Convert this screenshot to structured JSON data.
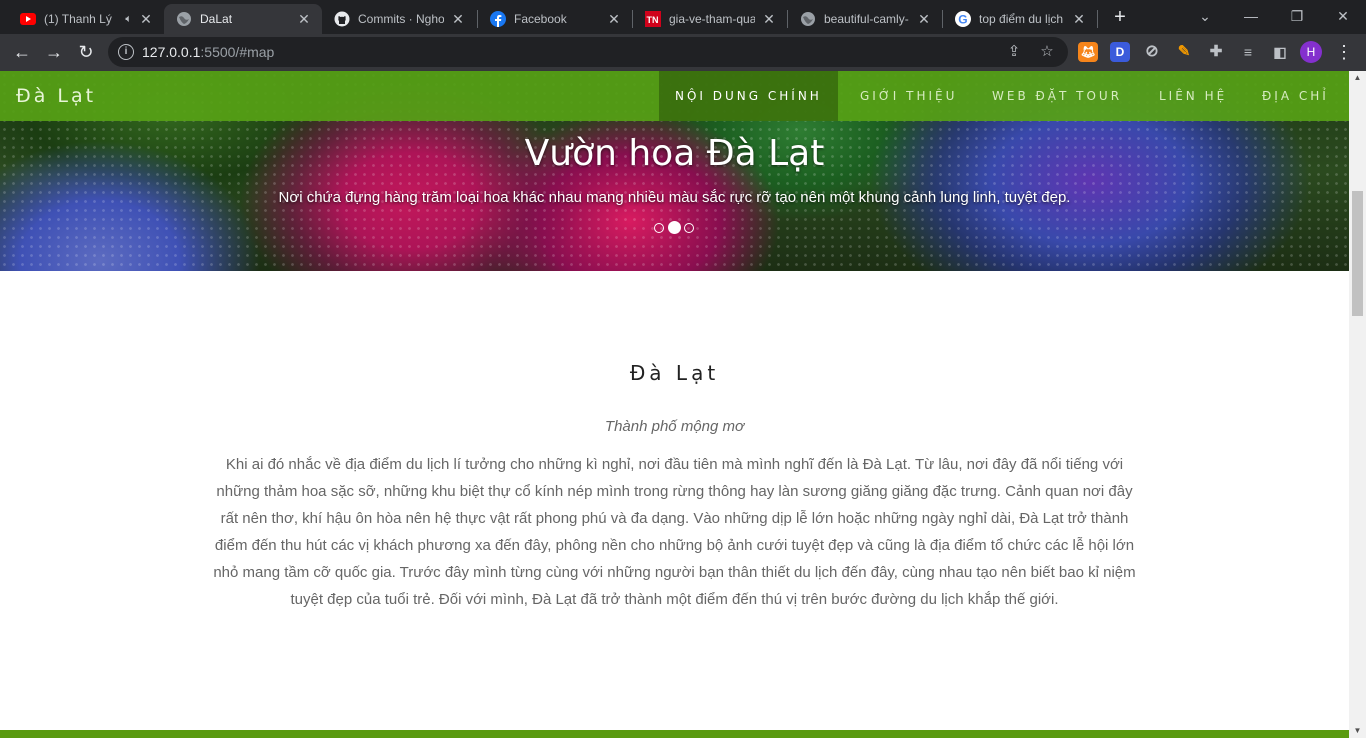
{
  "browser": {
    "tabs": [
      {
        "title": "(1) Thanh Lý",
        "icon": "youtube-icon",
        "muted_audio": true,
        "active": false
      },
      {
        "title": "DaLat",
        "icon": "globe-icon",
        "active": true
      },
      {
        "title": "Commits · Nghoa",
        "icon": "github-icon",
        "active": false
      },
      {
        "title": "Facebook",
        "icon": "facebook-icon",
        "active": false
      },
      {
        "title": "gia-ve-tham-qua",
        "icon": "thanhnien-icon",
        "active": false
      },
      {
        "title": "beautiful-camly-",
        "icon": "globe-icon",
        "active": false
      },
      {
        "title": "top điểm du lịch",
        "icon": "google-icon",
        "active": false
      }
    ],
    "url_host": "127.0.0.1",
    "url_rest": ":5500/#map",
    "profile_initial": "H",
    "ext_d_label": "D"
  },
  "site": {
    "brand": "Đà Lạt",
    "nav": [
      "NỘI DUNG CHÍNH",
      "GIỚI THIỆU",
      "WEB ĐẶT TOUR",
      "LIÊN HỆ",
      "ĐỊA CHỈ"
    ],
    "nav_active_index": 0,
    "accent": "#56a016",
    "hero": {
      "title": "Vườn hoa Đà Lạt",
      "subtitle": "Nơi chứa đựng hàng trăm loại hoa khác nhau mang nhiều màu sắc rực rỡ tạo nên một khung cảnh lung linh, tuyệt đẹp.",
      "slides": 3,
      "active_slide": 2
    },
    "section": {
      "title": "Đà Lạt",
      "subtitle": "Thành phố mộng mơ",
      "body": "Khi ai đó nhắc về địa điểm du lịch lí tưởng cho những kì nghỉ, nơi đầu tiên mà mình nghĩ đến là Đà Lạt. Từ lâu, nơi đây đã nổi tiếng với những thảm hoa sặc sỡ, những khu biệt thự cổ kính nép mình trong rừng thông hay làn sương giăng giăng đặc trưng. Cảnh quan nơi đây rất nên thơ, khí hậu ôn hòa nên hệ thực vật rất phong phú và đa dạng. Vào những dịp lễ lớn hoặc những ngày nghỉ dài, Đà Lạt trở thành điểm đến thu hút các vị khách phương xa đến đây, phông nền cho những bộ ảnh cưới tuyệt đẹp và cũng là địa điểm tổ chức các lễ hội lớn nhỏ mang tầm cỡ quốc gia. Trước đây mình từng cùng với những người bạn thân thiết du lịch đến đây, cùng nhau tạo nên biết bao kỉ niệm tuyệt đẹp của tuổi trẻ. Đối với mình, Đà Lạt đã trở thành một điểm đến thú vị trên bước đường du lịch khắp thế giới."
    }
  }
}
